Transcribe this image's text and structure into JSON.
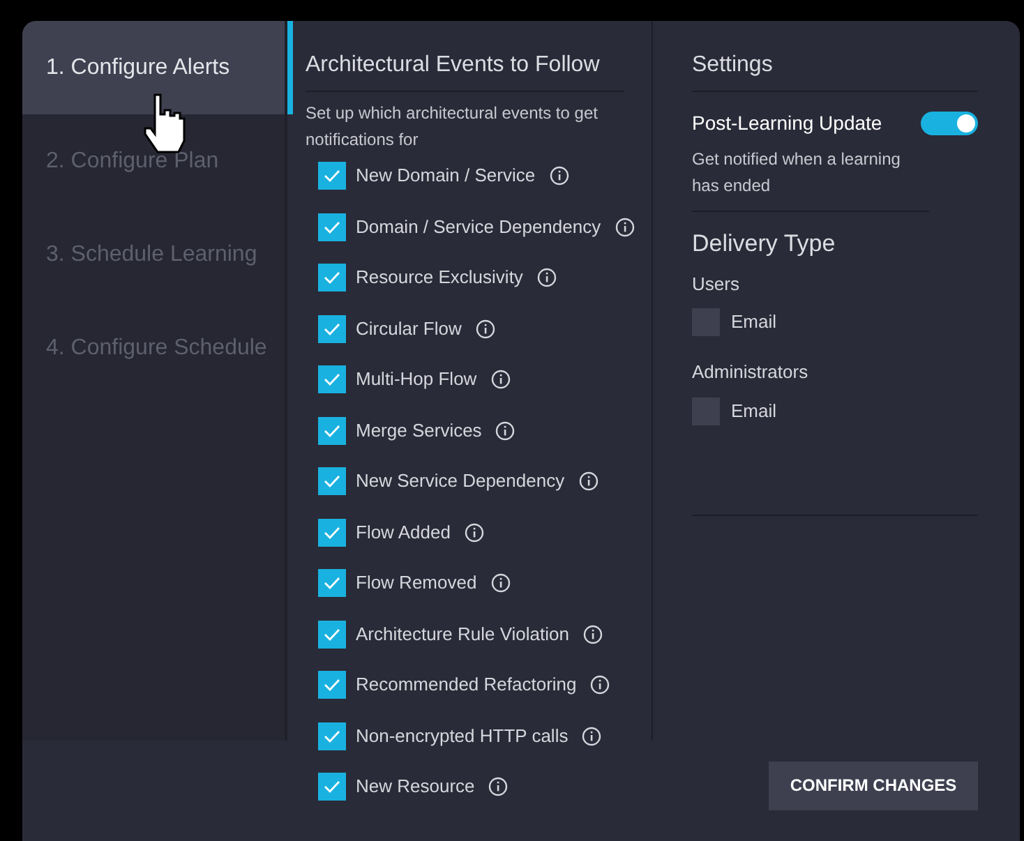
{
  "steps": [
    {
      "label": "1. Configure Alerts",
      "selected": true
    },
    {
      "label": "2. Configure Plan",
      "selected": false
    },
    {
      "label": "3. Schedule Learning",
      "selected": false
    },
    {
      "label": "4. Configure Schedule",
      "selected": false
    }
  ],
  "events": {
    "title": "Architectural Events to Follow",
    "description": "Set up which architectural events to get notifications for",
    "items": [
      {
        "label": "New Domain / Service",
        "checked": true
      },
      {
        "label": "Domain / Service Dependency",
        "checked": true
      },
      {
        "label": "Resource Exclusivity",
        "checked": true
      },
      {
        "label": "Circular Flow",
        "checked": true
      },
      {
        "label": "Multi-Hop Flow",
        "checked": true
      },
      {
        "label": "Merge Services",
        "checked": true
      },
      {
        "label": "New Service Dependency",
        "checked": true
      },
      {
        "label": "Flow Added",
        "checked": true
      },
      {
        "label": "Flow Removed",
        "checked": true
      },
      {
        "label": "Architecture Rule Violation",
        "checked": true
      },
      {
        "label": "Recommended Refactoring",
        "checked": true
      },
      {
        "label": "Non-encrypted HTTP calls",
        "checked": true
      },
      {
        "label": "New Resource",
        "checked": true
      }
    ]
  },
  "settings": {
    "title": "Settings",
    "toggle": {
      "label": "Post-Learning Update",
      "on": true,
      "description": "Get notified when a learning has ended"
    },
    "delivery_title": "Delivery Type",
    "groups": [
      {
        "label": "Users",
        "option": {
          "label": "Email",
          "checked": false
        }
      },
      {
        "label": "Administrators",
        "option": {
          "label": "Email",
          "checked": false
        }
      }
    ]
  },
  "confirm_button": "CONFIRM CHANGES"
}
